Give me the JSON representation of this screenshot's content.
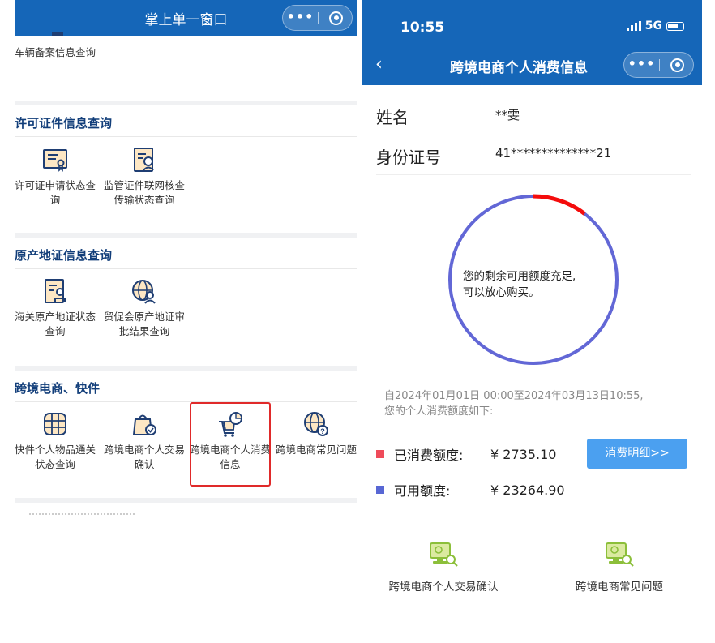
{
  "left": {
    "nav": {
      "title": "掌上单一窗口",
      "more_glyph": "•••"
    },
    "top_item": {
      "label": "车辆备案信息查询"
    },
    "sections": [
      {
        "title": "许可证件信息查询",
        "items": [
          {
            "label": "许可证申请状态查询",
            "icon": "certificate-icon"
          },
          {
            "label": "监管证件联网核查传输状态查询",
            "icon": "document-search-icon"
          }
        ]
      },
      {
        "title": "原产地证信息查询",
        "items": [
          {
            "label": "海关原产地证状态查询",
            "icon": "document-stamp-icon"
          },
          {
            "label": "贸促会原产地证审批结果查询",
            "icon": "globe-person-icon"
          }
        ]
      },
      {
        "title": "跨境电商、快件",
        "items": [
          {
            "label": "快件个人物品通关状态查询",
            "icon": "parcel-grid-icon"
          },
          {
            "label": "跨境电商个人交易确认",
            "icon": "shopping-bag-check-icon"
          },
          {
            "label": "跨境电商个人消费信息",
            "icon": "cart-chart-icon",
            "highlighted": true
          },
          {
            "label": "跨境电商常见问题",
            "icon": "globe-question-icon"
          }
        ]
      }
    ]
  },
  "right": {
    "status": {
      "time": "10:55",
      "network": "5G"
    },
    "nav": {
      "back_glyph": "‹",
      "title": "跨境电商个人消费信息",
      "more_glyph": "•••"
    },
    "profile": [
      {
        "label": "姓名",
        "value": "**雯"
      },
      {
        "label": "身份证号",
        "value": "41**************21"
      }
    ],
    "gauge": {
      "used_fraction": 0.105,
      "used_color": "#f40c0c",
      "available_color": "#6267d6",
      "message_line1": "您的剩余可用额度充足,",
      "message_line2": "可以放心购买。"
    },
    "period": {
      "line1": "自2024年01月01日 00:00至2024年03月13日10:55,",
      "line2": "您的个人消费额度如下:"
    },
    "amounts": {
      "used_label": "已消费额度:",
      "used_value": "¥ 2735.10",
      "used_color": "#ef4b5a",
      "available_label": "可用额度:",
      "available_value": "¥ 23264.90",
      "available_color": "#5867d4"
    },
    "detail_button": "消费明细>>",
    "links": [
      {
        "label": "跨境电商个人交易确认",
        "icon": "computer-search-icon"
      },
      {
        "label": "跨境电商常见问题",
        "icon": "computer-search-icon"
      }
    ]
  }
}
